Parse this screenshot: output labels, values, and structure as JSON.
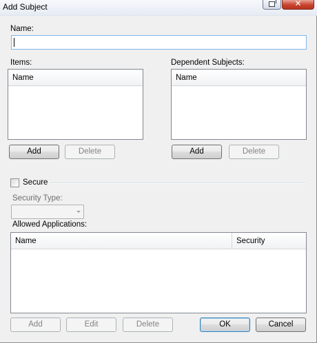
{
  "window": {
    "title": "Add Subject",
    "close_glyph": "✕"
  },
  "name_field": {
    "label": "Name:",
    "value": ""
  },
  "items": {
    "label": "Items:",
    "columns": [
      "Name"
    ],
    "add_label": "Add",
    "delete_label": "Delete"
  },
  "dependent_subjects": {
    "label": "Dependent Subjects:",
    "columns": [
      "Name"
    ],
    "add_label": "Add",
    "delete_label": "Delete"
  },
  "secure": {
    "label": "Secure",
    "checked": false
  },
  "security_type": {
    "label": "Security Type:",
    "value": ""
  },
  "allowed_applications": {
    "label": "Allowed Applications:",
    "columns": [
      "Name",
      "Security"
    ],
    "add_label": "Add",
    "edit_label": "Edit",
    "delete_label": "Delete"
  },
  "footer": {
    "ok_label": "OK",
    "cancel_label": "Cancel"
  },
  "icons": {
    "restore": "restore-icon",
    "close": "close-icon",
    "dropdown": "chevron-down-icon"
  }
}
